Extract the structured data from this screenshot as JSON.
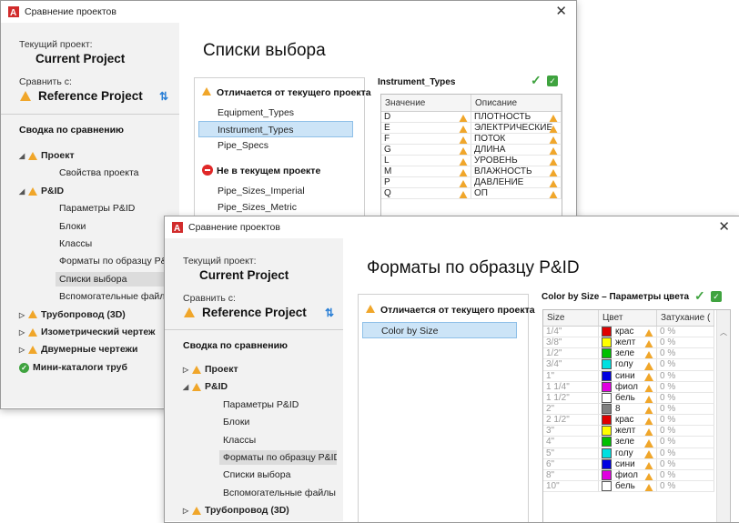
{
  "win1": {
    "title": "Сравнение проектов",
    "current_label": "Текущий проект:",
    "current_project": "Current Project",
    "compare_label": "Сравнить с:",
    "compare_project": "Reference Project",
    "summary_title": "Сводка по сравнению",
    "tree": [
      {
        "label": "Проект",
        "level": 0,
        "caret": "◢",
        "status": "warn"
      },
      {
        "label": "Свойства проекта",
        "level": 1
      },
      {
        "label": "P&ID",
        "level": 0,
        "caret": "◢",
        "status": "warn"
      },
      {
        "label": "Параметры P&ID",
        "level": 1
      },
      {
        "label": "Блоки",
        "level": 1
      },
      {
        "label": "Классы",
        "level": 1
      },
      {
        "label": "Форматы по образцу P&ID",
        "level": 1
      },
      {
        "label": "Списки выбора",
        "level": 1,
        "selected": true
      },
      {
        "label": "Вспомогательные файлы",
        "level": 1
      },
      {
        "label": "Трубопровод (3D)",
        "level": 0,
        "caret": "▷",
        "status": "warn"
      },
      {
        "label": "Изометрический чертеж",
        "level": 0,
        "caret": "▷",
        "status": "warn"
      },
      {
        "label": "Двумерные чертежи",
        "level": 0,
        "caret": "▷",
        "status": "warn"
      },
      {
        "label": "Мини-каталоги труб",
        "level": 0,
        "status": "ok"
      }
    ],
    "page_title": "Списки выбора",
    "differs_label": "Отличается от текущего проекта",
    "differs_items": [
      "Equipment_Types",
      "Instrument_Types",
      "Pipe_Specs"
    ],
    "missing_label": "Не в текущем проекте",
    "missing_items": [
      "Pipe_Sizes_Imperial",
      "Pipe_Sizes_Metric"
    ],
    "table_title": "Instrument_Types",
    "col_value": "Значение",
    "col_desc": "Описание",
    "rows": [
      {
        "v": "D",
        "d": "ПЛОТНОСТЬ"
      },
      {
        "v": "E",
        "d": "ЭЛЕКТРИЧЕСКИЕ"
      },
      {
        "v": "F",
        "d": "ПОТОК"
      },
      {
        "v": "G",
        "d": "ДЛИНА"
      },
      {
        "v": "L",
        "d": "УРОВЕНЬ"
      },
      {
        "v": "M",
        "d": "ВЛАЖНОСТЬ"
      },
      {
        "v": "P",
        "d": "ДАВЛЕНИЕ"
      },
      {
        "v": "Q",
        "d": "ОП"
      }
    ]
  },
  "win2": {
    "title": "Сравнение проектов",
    "current_label": "Текущий проект:",
    "current_project": "Current Project",
    "compare_label": "Сравнить с:",
    "compare_project": "Reference Project",
    "summary_title": "Сводка по сравнению",
    "tree": [
      {
        "label": "Проект",
        "level": 0,
        "caret": "▷",
        "status": "warn"
      },
      {
        "label": "P&ID",
        "level": 0,
        "caret": "◢",
        "status": "warn"
      },
      {
        "label": "Параметры P&ID",
        "level": 1
      },
      {
        "label": "Блоки",
        "level": 1
      },
      {
        "label": "Классы",
        "level": 1
      },
      {
        "label": "Форматы по образцу P&ID",
        "level": 1,
        "selected": true
      },
      {
        "label": "Списки выбора",
        "level": 1
      },
      {
        "label": "Вспомогательные файлы",
        "level": 1
      },
      {
        "label": "Трубопровод (3D)",
        "level": 0,
        "caret": "▷",
        "status": "warn"
      }
    ],
    "page_title": "Форматы по образцу P&ID",
    "differs_label": "Отличается от текущего проекта",
    "differs_items": [
      "Color by Size"
    ],
    "table_title": "Color by Size  – Параметры цвета",
    "col_size": "Size",
    "col_color": "Цвет",
    "col_fade": "Затухание (",
    "rows": [
      {
        "size": "1/4\"",
        "c": "крас",
        "hex": "#e00000",
        "fade": "0 %"
      },
      {
        "size": "3/8\"",
        "c": "желт",
        "hex": "#ffff00",
        "fade": "0 %"
      },
      {
        "size": "1/2\"",
        "c": "зеле",
        "hex": "#00c000",
        "fade": "0 %"
      },
      {
        "size": "3/4\"",
        "c": "голу",
        "hex": "#00e0e0",
        "fade": "0 %"
      },
      {
        "size": "1\"",
        "c": "сини",
        "hex": "#0000e0",
        "fade": "0 %"
      },
      {
        "size": "1 1/4\"",
        "c": "фиол",
        "hex": "#e000e0",
        "fade": "0 %"
      },
      {
        "size": "1 1/2\"",
        "c": "бель",
        "hex": "#ffffff",
        "fade": "0 %"
      },
      {
        "size": "2\"",
        "c": "8",
        "hex": "#808080",
        "fade": "0 %"
      },
      {
        "size": "2 1/2\"",
        "c": "крас",
        "hex": "#e00000",
        "fade": "0 %"
      },
      {
        "size": "3\"",
        "c": "желт",
        "hex": "#ffff00",
        "fade": "0 %"
      },
      {
        "size": "4\"",
        "c": "зеле",
        "hex": "#00c000",
        "fade": "0 %"
      },
      {
        "size": "5\"",
        "c": "голу",
        "hex": "#00e0e0",
        "fade": "0 %"
      },
      {
        "size": "6\"",
        "c": "сини",
        "hex": "#0000e0",
        "fade": "0 %"
      },
      {
        "size": "8\"",
        "c": "фиол",
        "hex": "#e000e0",
        "fade": "0 %"
      },
      {
        "size": "10\"",
        "c": "бель",
        "hex": "#ffffff",
        "fade": "0 %"
      }
    ]
  },
  "colors": {
    "warn": "#f0a62a",
    "ok": "#3fa33f",
    "select": "#cce4f7",
    "error": "#e02828"
  }
}
